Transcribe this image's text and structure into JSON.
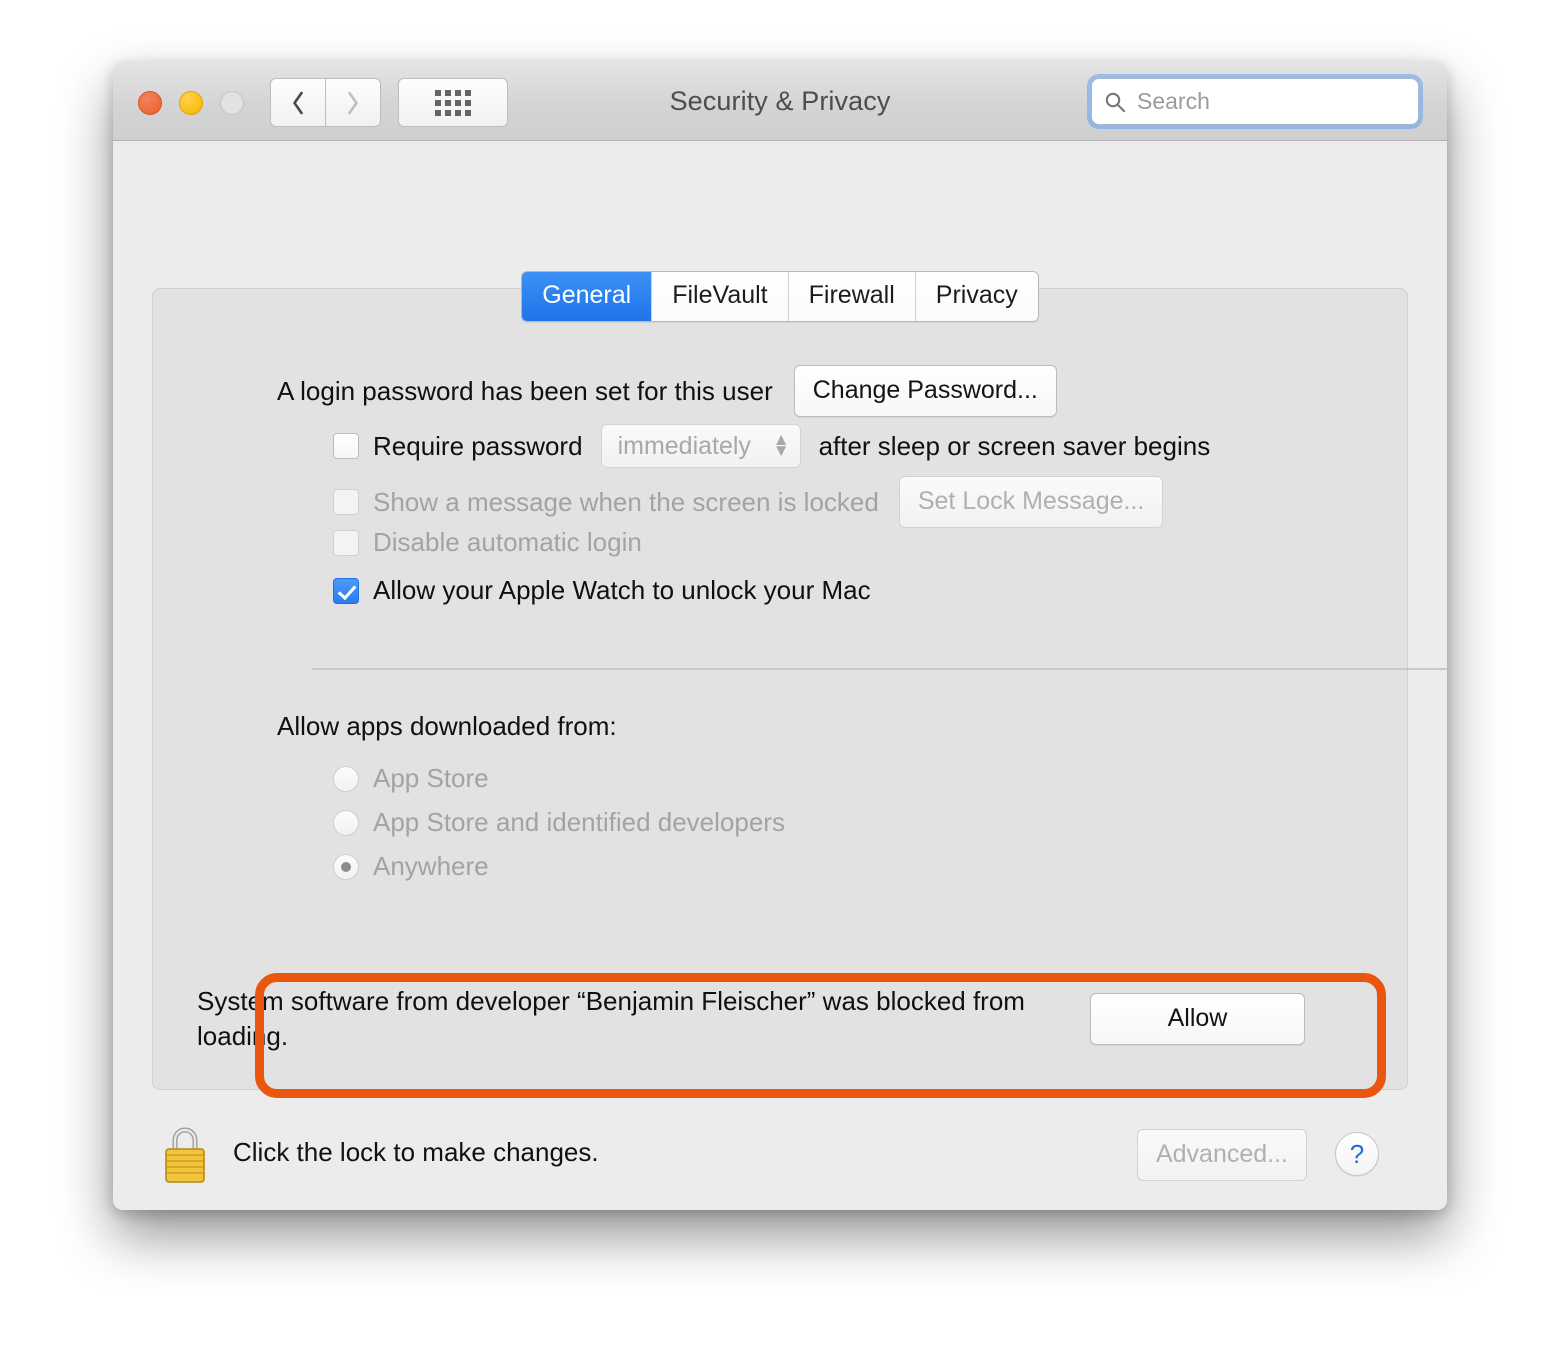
{
  "window": {
    "title": "Security & Privacy",
    "traffic_lights": [
      "close",
      "minimize",
      "zoom"
    ],
    "nav": {
      "back_icon": "chevron-left-icon",
      "forward_icon": "chevron-right-icon",
      "show_all_icon": "grid-dots-icon"
    },
    "search": {
      "placeholder": "Search",
      "value": "",
      "icon": "search-icon"
    }
  },
  "tabs": [
    {
      "label": "General",
      "active": true
    },
    {
      "label": "FileVault",
      "active": false
    },
    {
      "label": "Firewall",
      "active": false
    },
    {
      "label": "Privacy",
      "active": false
    }
  ],
  "general": {
    "password_status": "A login password has been set for this user",
    "change_password_button": "Change Password...",
    "require_password": {
      "label": "Require password",
      "checked": false,
      "delay_value": "immediately",
      "suffix": "after sleep or screen saver begins"
    },
    "show_message": {
      "label": "Show a message when the screen is locked",
      "checked": false,
      "button": "Set Lock Message..."
    },
    "disable_auto_login": {
      "label": "Disable automatic login",
      "checked": false
    },
    "apple_watch": {
      "label": "Allow your Apple Watch to unlock your Mac",
      "checked": true
    },
    "download_source": {
      "title": "Allow apps downloaded from:",
      "options": [
        {
          "label": "App Store",
          "selected": false
        },
        {
          "label": "App Store and identified developers",
          "selected": false
        },
        {
          "label": "Anywhere",
          "selected": true
        }
      ]
    },
    "blocked_notice": {
      "message": "System software from developer “Benjamin Fleischer” was blocked from loading.",
      "allow_button": "Allow",
      "highlight_color": "#e9560d"
    }
  },
  "footer": {
    "lock_icon": "padlock-icon",
    "lock_text": "Click the lock to make changes.",
    "advanced_button": "Advanced...",
    "help_button": "?"
  },
  "colors": {
    "accent_blue": "#2a7df0",
    "highlight_orange": "#e9560d",
    "window_bg": "#ececec",
    "panel_bg": "#e2e2e2"
  }
}
